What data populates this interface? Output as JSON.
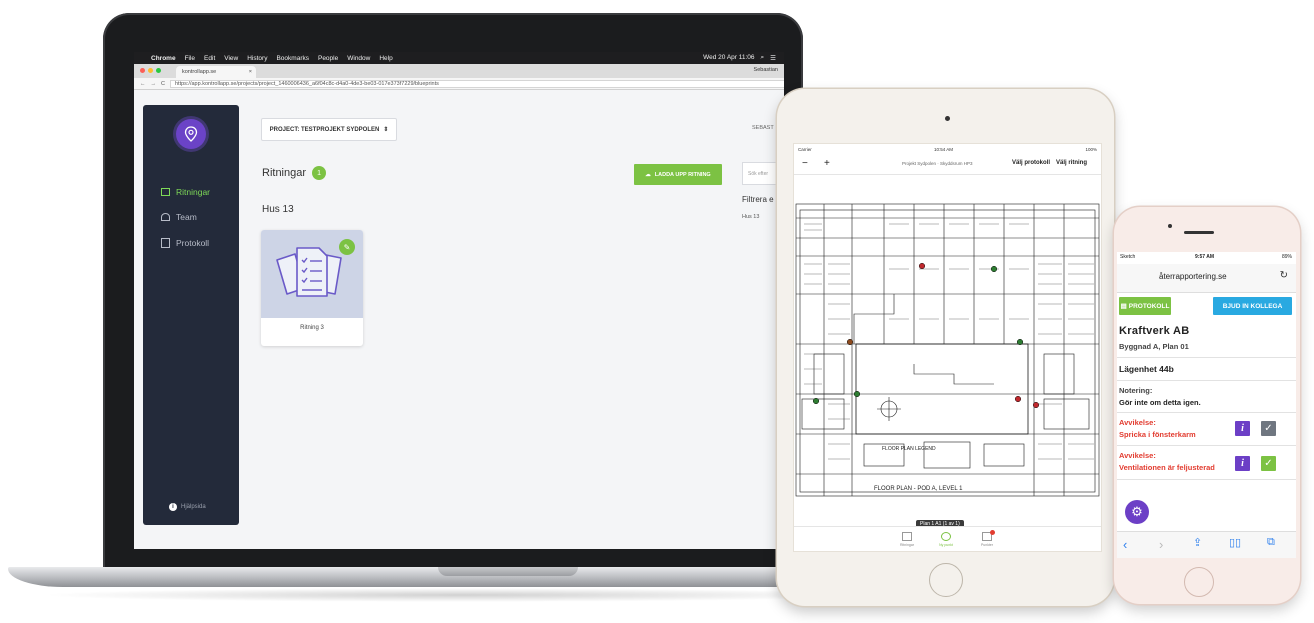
{
  "laptop": {
    "menubar": {
      "apple": "",
      "items": [
        "Chrome",
        "File",
        "Edit",
        "View",
        "History",
        "Bookmarks",
        "People",
        "Window",
        "Help"
      ],
      "right": "Wed 20 Apr 11:06"
    },
    "tab_title": "kontrollapp.se",
    "profile": "Sebastian",
    "url": "https://app.kontrollapp.se/projects/project_1460006436_a6f04c8c-d4a0-4de3-be03-017e373f7229/blueprints",
    "sidebar": {
      "items": [
        {
          "label": "Ritningar",
          "active": true
        },
        {
          "label": "Team",
          "active": false
        },
        {
          "label": "Protokoll",
          "active": false
        }
      ],
      "help_label": "Hjälpsida"
    },
    "project_select": "PROJECT: TESTPROJEKT SYDPOLEN",
    "user_short": "SEBAST",
    "section_title": "Ritningar",
    "section_count": "1",
    "upload_button": "LADDA UPP RITNING",
    "search_placeholder": "Sök efter",
    "filter_title": "Filtrera e",
    "filter_item": "Hus 13",
    "group_title": "Hus 13",
    "card_label": "Ritning 3"
  },
  "tablet": {
    "status_left": "Carrier",
    "status_time": "10:54 AM",
    "status_right": "100%",
    "zoom_out": "−",
    "zoom_in": "+",
    "breadcrumb": "Projekt Sydpolen · Skyddsrum HP3",
    "select_protocol": "Välj protokoll",
    "select_drawing": "Välj ritning",
    "plan_label": "FLOOR PLAN LEGEND",
    "plan_title": "FLOOR PLAN - POD A, LEVEL 1",
    "plan_tooltip": "Plan 1 A1 (1 av 1)",
    "footer_tabs": [
      "Ritningar",
      "Ny punkt",
      "Punkter"
    ],
    "markers": [
      {
        "color": "#c0282d"
      },
      {
        "color": "#2e7d32"
      },
      {
        "color": "#8d4a1e"
      },
      {
        "color": "#2e7d32"
      },
      {
        "color": "#2e7d32"
      },
      {
        "color": "#2e7d32"
      },
      {
        "color": "#c0282d"
      },
      {
        "color": "#c0282d"
      }
    ]
  },
  "phone": {
    "status_left": "Sketch",
    "status_time": "9:57 AM",
    "status_right": "89%",
    "url": "återrapportering.se",
    "protokoll_button": "PROTOKOLL",
    "invite_button": "BJUD IN KOLLEGA",
    "company": "Kraftverk AB",
    "building": "Byggnad A, Plan 01",
    "unit": "Lägenhet 44b",
    "note_label": "Notering:",
    "note_text": "Gör inte om detta igen.",
    "deviations": [
      {
        "label": "Avvikelse:",
        "text": "Spricka i fönsterkarm",
        "checked": false
      },
      {
        "label": "Avvikelse:",
        "text": "Ventilationen är feljusterad",
        "checked": true
      }
    ]
  },
  "colors": {
    "green": "#7cc243",
    "purple": "#6c3fc6",
    "sidebar": "#232a3a",
    "blue_button": "#29a9e1",
    "red_text": "#e23c30"
  }
}
